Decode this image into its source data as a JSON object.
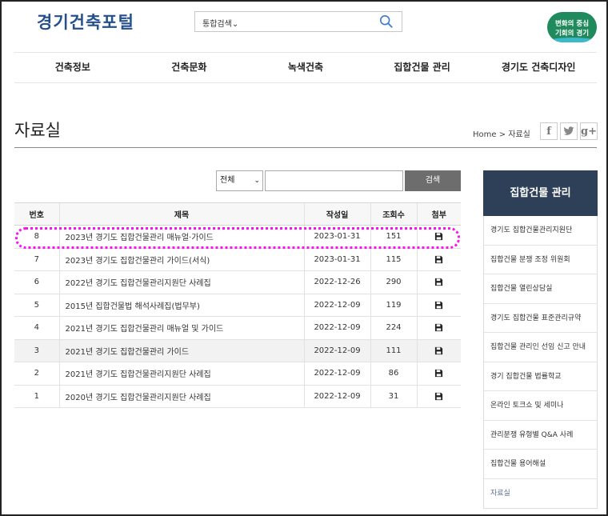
{
  "header": {
    "logo": "경기건축포털",
    "search_scope": "통합검색",
    "badge_line1": "변화의 중심",
    "badge_line2": "기회의 경기"
  },
  "nav": [
    "건축정보",
    "건축문화",
    "녹색건축",
    "집합건물 관리",
    "경기도 건축디자인"
  ],
  "page": {
    "title": "자료실",
    "breadcrumb": "Home > 자료실",
    "share": [
      "f",
      "t",
      "g+"
    ]
  },
  "board_search": {
    "category": "전체",
    "keyword_value": "",
    "button": "검색"
  },
  "table": {
    "headers": [
      "번호",
      "제목",
      "작성일",
      "조회수",
      "첨부"
    ],
    "rows": [
      {
        "no": "8",
        "title": "2023년 경기도 집합건물관리 매뉴얼·가이드",
        "date": "2023-01-31",
        "views": "151",
        "attachment": "floppy-disk-icon"
      },
      {
        "no": "7",
        "title": "2023년 경기도 집합건물관리 가이드(서식)",
        "date": "2023-01-31",
        "views": "115",
        "attachment": "floppy-disk-icon"
      },
      {
        "no": "6",
        "title": "2022년 경기도 집합건물관리지원단 사례집",
        "date": "2022-12-26",
        "views": "290",
        "attachment": "floppy-disk-icon"
      },
      {
        "no": "5",
        "title": "2015년 집합건물법 해석사례집(법무부)",
        "date": "2022-12-09",
        "views": "119",
        "attachment": "floppy-disk-icon"
      },
      {
        "no": "4",
        "title": "2021년 경기도 집합건물관리 매뉴얼 및 가이드",
        "date": "2022-12-09",
        "views": "224",
        "attachment": "floppy-disk-icon"
      },
      {
        "no": "3",
        "title": "2021년 경기도 집합건물관리 가이드",
        "date": "2022-12-09",
        "views": "111",
        "attachment": "floppy-disk-icon"
      },
      {
        "no": "2",
        "title": "2021년 경기도 집합건물관리지원단 사례집",
        "date": "2022-12-09",
        "views": "86",
        "attachment": "floppy-disk-icon"
      },
      {
        "no": "1",
        "title": "2020년 경기도 집합건물관리지원단 사례집",
        "date": "2022-12-09",
        "views": "31",
        "attachment": "floppy-disk-icon"
      }
    ]
  },
  "sidebar": {
    "title": "집합건물 관리",
    "items": [
      "경기도 집합건물관리지원단",
      "집합건물 분쟁 조정 위원회",
      "집합건물 열린상담실",
      "경기도 집합건물 표준관리규약",
      "집합건물 관리인 선임 신고 안내",
      "경기 집합건물 법률학교",
      "온라인 토크쇼 및 세미나",
      "관리분쟁 유형별 Q&A 사례",
      "집합건물 용어해설",
      "자료실"
    ]
  },
  "colors": {
    "logo": "#24508c",
    "sidebar_header": "#2e4058",
    "search_button": "#6d6d6d",
    "highlight": "#ff10f0",
    "badge": "#1f8a5c"
  }
}
